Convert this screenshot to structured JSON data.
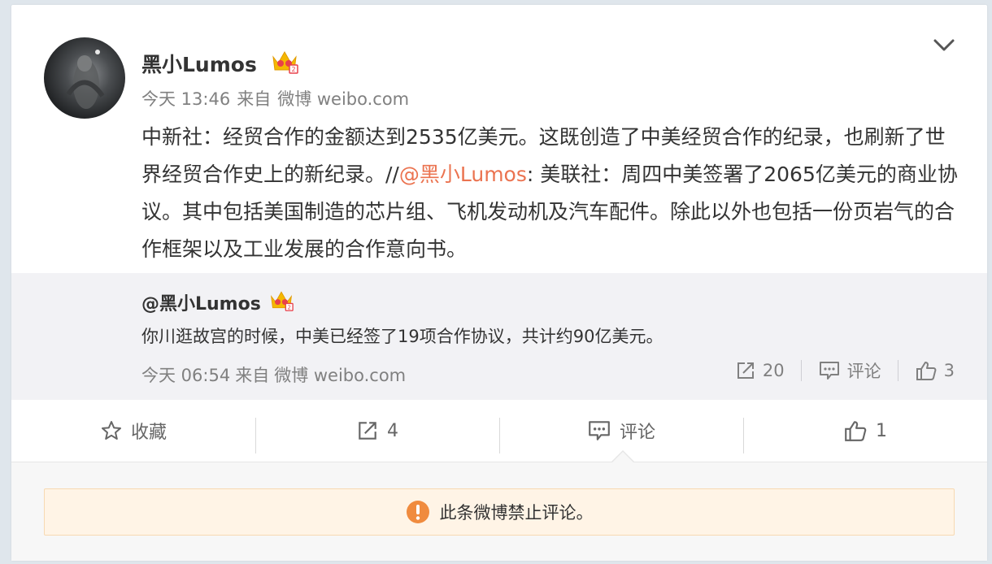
{
  "post": {
    "username": "黑小Lumos",
    "time": "今天 13:46",
    "from_label": "来自",
    "source": "微博 weibo.com",
    "text_before_mention": "中新社：经贸合作的金额达到2535亿美元。这既创造了中美经贸合作的纪录，也刷新了世界经贸合作史上的新纪录。//",
    "mention": "@黑小Lumos",
    "text_after_mention": ": 美联社：周四中美签署了2065亿美元的商业协议。其中包括美国制造的芯片组、飞机发动机及汽车配件。除此以外也包括一份页岩气的合作框架以及工业发展的合作意向书。"
  },
  "repost": {
    "username": "@黑小Lumos",
    "text": "你川逛故宫的时候，中美已经签了19项合作协议，共计约90亿美元。",
    "time": "今天 06:54",
    "from_label": "来自",
    "source": "微博 weibo.com",
    "share_count": "20",
    "comment_label": "评论",
    "like_count": "3"
  },
  "actions": {
    "favorite_label": "收藏",
    "share_count": "4",
    "comment_label": "评论",
    "like_count": "1"
  },
  "comments": {
    "disabled_notice": "此条微博禁止评论。"
  },
  "colors": {
    "mention": "#eb7350",
    "notice_bg": "#fff4e6",
    "notice_icon": "#f08b3e",
    "vip_crown": "#f5b800"
  },
  "icons": {
    "menu": "chevron-down-icon",
    "vip": "vip-crown-icon",
    "favorite": "star-icon",
    "share": "share-icon",
    "comment": "comment-icon",
    "like": "thumbs-up-icon",
    "notice": "warning-icon"
  }
}
